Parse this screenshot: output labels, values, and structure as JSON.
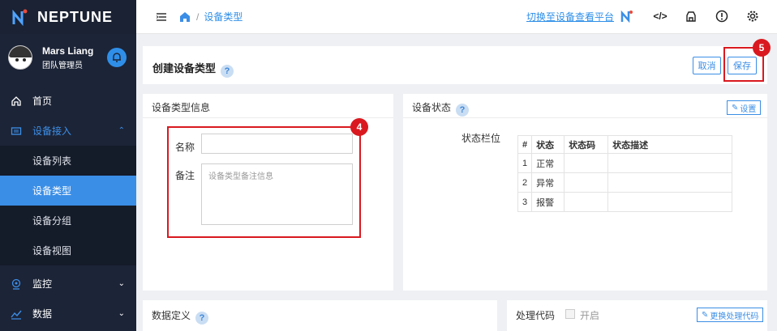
{
  "brand": {
    "name": "NEPTUNE",
    "accent": "#3b8ee6",
    "sidebar_bg": "#1c2437"
  },
  "user": {
    "name": "Mars Liang",
    "role": "团队管理员"
  },
  "sidebar": {
    "items": [
      {
        "label": "首页",
        "icon": "home-icon"
      },
      {
        "label": "设备接入",
        "icon": "device-icon",
        "expanded": true,
        "children": [
          {
            "label": "设备列表"
          },
          {
            "label": "设备类型",
            "active": true
          },
          {
            "label": "设备分组"
          },
          {
            "label": "设备视图"
          }
        ]
      },
      {
        "label": "监控",
        "icon": "monitor-icon"
      },
      {
        "label": "数据",
        "icon": "data-icon"
      }
    ]
  },
  "topbar": {
    "breadcrumb": "设备类型",
    "switch_link": "切换至设备查看平台"
  },
  "page": {
    "title": "创建设备类型",
    "help": "?",
    "cancel_label": "取消",
    "save_label": "保存"
  },
  "info": {
    "title": "设备类型信息",
    "name_label": "名称",
    "name_value": "",
    "remark_label": "备注",
    "remark_placeholder": "设备类型备注信息"
  },
  "status": {
    "title": "设备状态",
    "settings_label": "设置",
    "field_label": "状态栏位",
    "headers": [
      "#",
      "状态",
      "状态码",
      "状态描述"
    ],
    "rows": [
      [
        "1",
        "正常",
        "",
        ""
      ],
      [
        "2",
        "异常",
        "",
        ""
      ],
      [
        "3",
        "报警",
        "",
        ""
      ]
    ]
  },
  "data_def": {
    "title": "数据定义"
  },
  "code": {
    "title": "处理代码",
    "enable_label": "开启",
    "change_label": "更换处理代码"
  },
  "annotations": {
    "badge_4": "4",
    "badge_5": "5",
    "highlight_color": "#d9191f"
  }
}
